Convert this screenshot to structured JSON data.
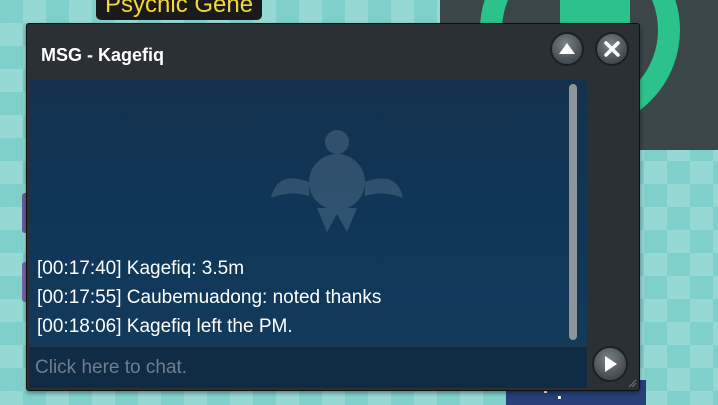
{
  "npc": {
    "name": "Psychic Gene"
  },
  "chat": {
    "title": "MSG - Kagefiq",
    "messages": [
      "[00:17:40] Kagefiq: 3.5m",
      "[00:17:55] Caubemuadong: noted thanks",
      "[00:18:06] Kagefiq left the PM."
    ],
    "input_placeholder": "Click here to chat.",
    "icons": {
      "minimize": "chevron-up-icon",
      "close": "close-icon",
      "send": "play-arrow-icon",
      "watermark": "pokemon-emblem-icon"
    }
  },
  "colors": {
    "name_tag_text": "#f2d73b",
    "window_frame": "#2b3034",
    "message_area": "#0f3657",
    "world_accent": "#2cc28c"
  }
}
